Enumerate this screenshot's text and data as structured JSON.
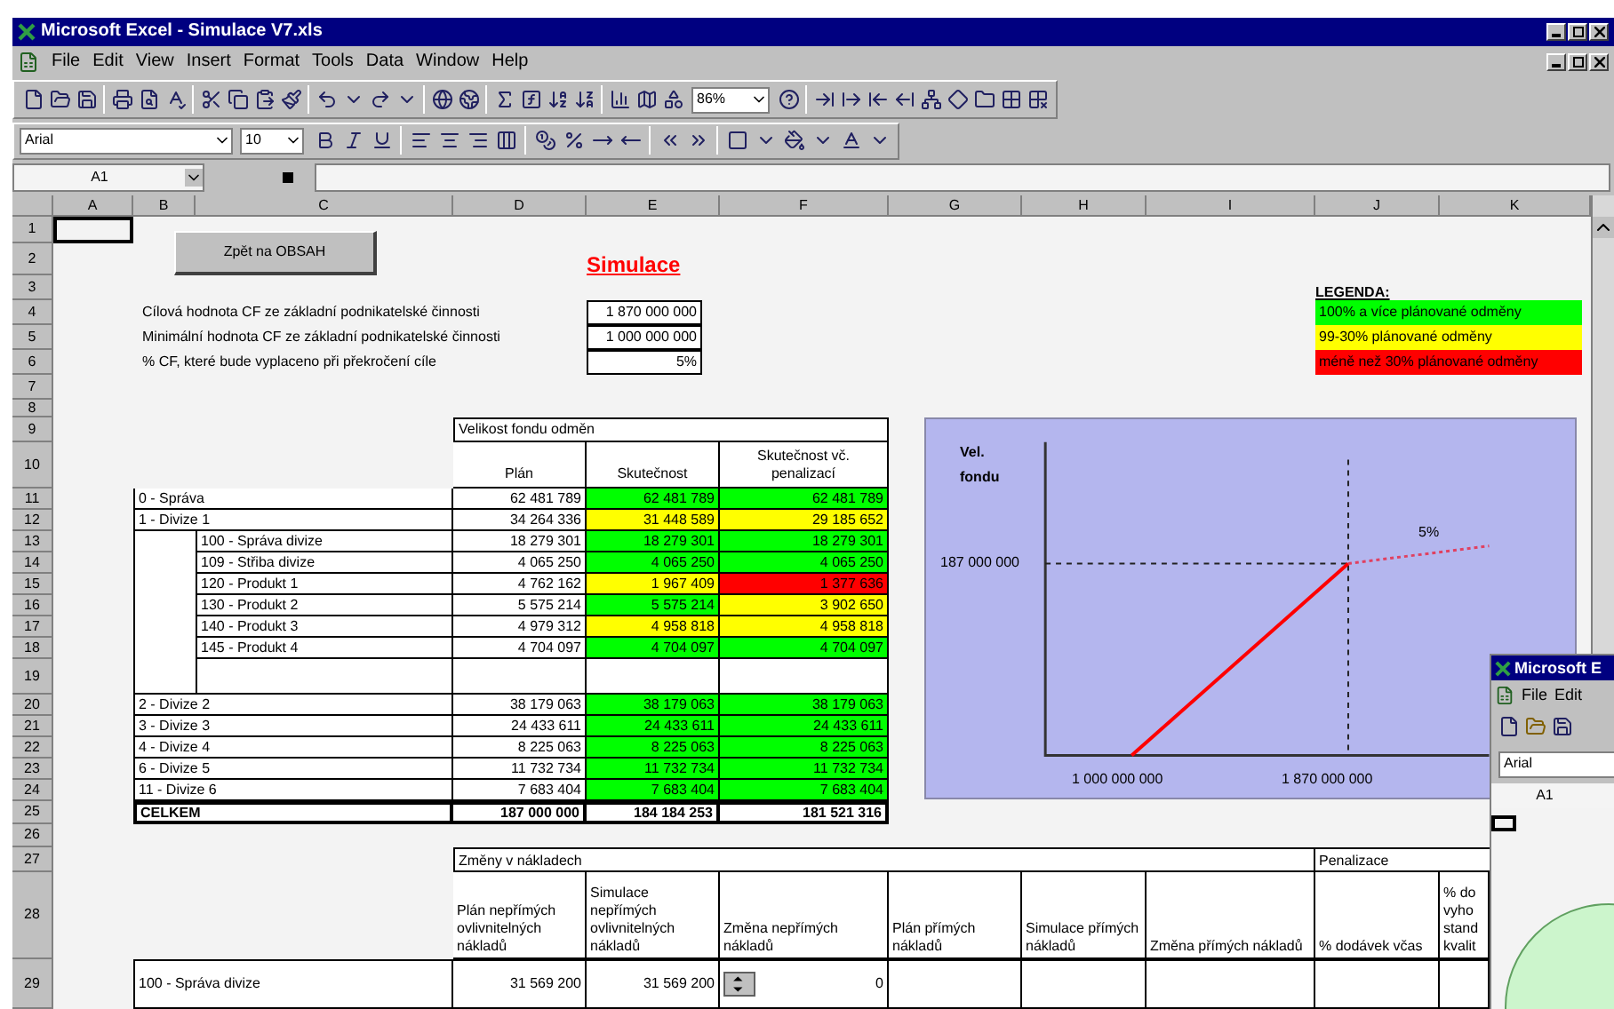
{
  "window": {
    "title": "Microsoft Excel - Simulace V7.xls"
  },
  "menu": [
    "File",
    "Edit",
    "View",
    "Insert",
    "Format",
    "Tools",
    "Data",
    "Window",
    "Help"
  ],
  "toolbar": {
    "zoom": "86%"
  },
  "formatting": {
    "font": "Arial",
    "size": "10"
  },
  "formula_bar": {
    "name_box": "A1"
  },
  "sheet": {
    "columns": [
      "A",
      "B",
      "C",
      "D",
      "E",
      "F",
      "G",
      "H",
      "I",
      "J",
      "K"
    ],
    "rows": [
      "1",
      "2",
      "3",
      "4",
      "5",
      "6",
      "7",
      "8",
      "9",
      "10",
      "11",
      "12",
      "13",
      "14",
      "15",
      "16",
      "17",
      "18",
      "19",
      "20",
      "21",
      "22",
      "23",
      "24",
      "25",
      "26",
      "27",
      "28",
      "29"
    ],
    "back_button": "Zpět na OBSAH",
    "title": "Simulace",
    "parameters": [
      {
        "label": "Cílová hodnota CF ze základní podnikatelské činnosti",
        "value": "1 870 000 000"
      },
      {
        "label": "Minimální hodnota CF ze základní podnikatelské činnosti",
        "value": "1 000 000 000"
      },
      {
        "label": "% CF, které bude vyplaceno při překročení cíle",
        "value": "5%"
      }
    ],
    "legend": {
      "title": "LEGENDA:",
      "items": [
        {
          "label": "100% a více plánované odměny",
          "color": "#00ff00"
        },
        {
          "label": "99-30% plánované odměny",
          "color": "#ffff00"
        },
        {
          "label": "méně než 30% plánované odměny",
          "color": "#ff0000"
        }
      ]
    },
    "fund_table": {
      "group_header": "Velikost fondu odměn",
      "columns": [
        "Plán",
        "Skutečnost",
        "Skutečnost vč. penalizací"
      ],
      "rows": [
        {
          "name": "0 - Správa",
          "plan": "62 481 789",
          "actual": {
            "value": "62 481 789",
            "color": "#00ff00"
          },
          "penalized": {
            "value": "62 481 789",
            "color": "#00ff00"
          }
        },
        {
          "name": "1 - Divize 1",
          "plan": "34 264 336",
          "actual": {
            "value": "31 448 589",
            "color": "#ffff00"
          },
          "penalized": {
            "value": "29 185 652",
            "color": "#ffff00"
          },
          "children": [
            {
              "name": "100 - Správa divize",
              "plan": "18 279 301",
              "actual": {
                "value": "18 279 301",
                "color": "#00ff00"
              },
              "penalized": {
                "value": "18 279 301",
                "color": "#00ff00"
              }
            },
            {
              "name": "109 - Střiba divize",
              "plan": "4 065 250",
              "actual": {
                "value": "4 065 250",
                "color": "#00ff00"
              },
              "penalized": {
                "value": "4 065 250",
                "color": "#00ff00"
              }
            },
            {
              "name": "120 - Produkt 1",
              "plan": "4 762 162",
              "actual": {
                "value": "1 967 409",
                "color": "#ffff00"
              },
              "penalized": {
                "value": "1 377 636",
                "color": "#ff0000"
              }
            },
            {
              "name": "130 - Produkt 2",
              "plan": "5 575 214",
              "actual": {
                "value": "5 575 214",
                "color": "#00ff00"
              },
              "penalized": {
                "value": "3 902 650",
                "color": "#ffff00"
              }
            },
            {
              "name": "140 - Produkt 3",
              "plan": "4 979 312",
              "actual": {
                "value": "4 958 818",
                "color": "#ffff00"
              },
              "penalized": {
                "value": "4 958 818",
                "color": "#ffff00"
              }
            },
            {
              "name": "145 - Produkt 4",
              "plan": "4 704 097",
              "actual": {
                "value": "4 704 097",
                "color": "#00ff00"
              },
              "penalized": {
                "value": "4 704 097",
                "color": "#00ff00"
              }
            }
          ]
        },
        {
          "name": "2 - Divize 2",
          "plan": "38 179 063",
          "actual": {
            "value": "38 179 063",
            "color": "#00ff00"
          },
          "penalized": {
            "value": "38 179 063",
            "color": "#00ff00"
          }
        },
        {
          "name": "3 - Divize 3",
          "plan": "24 433 611",
          "actual": {
            "value": "24 433 611",
            "color": "#00ff00"
          },
          "penalized": {
            "value": "24 433 611",
            "color": "#00ff00"
          }
        },
        {
          "name": "4 - Divize 4",
          "plan": "8 225 063",
          "actual": {
            "value": "8 225 063",
            "color": "#00ff00"
          },
          "penalized": {
            "value": "8 225 063",
            "color": "#00ff00"
          }
        },
        {
          "name": "6 - Divize 5",
          "plan": "11 732 734",
          "actual": {
            "value": "11 732 734",
            "color": "#00ff00"
          },
          "penalized": {
            "value": "11 732 734",
            "color": "#00ff00"
          }
        },
        {
          "name": "11 - Divize 6",
          "plan": "7 683 404",
          "actual": {
            "value": "7 683 404",
            "color": "#00ff00"
          },
          "penalized": {
            "value": "7 683 404",
            "color": "#00ff00"
          }
        }
      ],
      "total": {
        "name": "CELKEM",
        "plan": "187 000 000",
        "actual": "184 184 253",
        "penalized": "181 521 316"
      }
    },
    "diagram": {
      "y_label": "Vel. fondu",
      "y_tick": "187 000 000",
      "x_ticks": [
        "1 000 000 000",
        "1 870 000 000"
      ],
      "annotation": "5%"
    },
    "cost_table": {
      "group_header": "Změny v nákladech",
      "columns": [
        "Plán nepřímých ovlivnitelných nákladů",
        "Simulace nepřímých ovlivnitelných nákladů",
        "Změna nepřímých nákladů",
        "Plán přímých nákladů",
        "Simulace přímých nákladů",
        "Změna přímých nákladů"
      ],
      "penalty_header": "Penalizace",
      "penalty_columns": [
        "% dodávek včas",
        "% do\nvyho\nstand\nkvalit"
      ],
      "rows": [
        {
          "name": "100 - Správa divize",
          "values": [
            "31 569 200",
            "31 569 200",
            "0"
          ]
        }
      ]
    }
  },
  "second_window": {
    "title": "Microsoft E",
    "menu": [
      "File",
      "Edit"
    ],
    "font": "Arial",
    "name_box": "A1"
  }
}
